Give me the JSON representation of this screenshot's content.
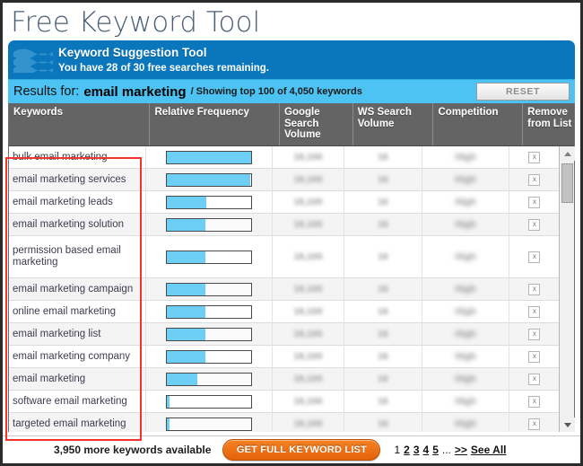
{
  "page_title": "Free Keyword Tool",
  "banner": {
    "icon": "waves-icon",
    "title": "Keyword Suggestion Tool",
    "subtitle": "You have 28 of 30 free searches remaining."
  },
  "results_bar": {
    "label": "Results for:",
    "query": "email marketing",
    "showing": "/ Showing top 100 of 4,050 keywords",
    "reset_label": "RESET"
  },
  "table": {
    "columns": [
      "Keywords",
      "Relative Frequency",
      "Google Search Volume",
      "WS Search Volume",
      "Competition",
      "Remove from List"
    ],
    "rows": [
      {
        "keyword": "bulk email marketing",
        "frequency_pct": 100,
        "google_search_volume": "18,100",
        "ws_search_volume": "16",
        "competition": "High",
        "remove": "x"
      },
      {
        "keyword": "email marketing services",
        "frequency_pct": 99,
        "google_search_volume": "18,100",
        "ws_search_volume": "16",
        "competition": "High",
        "remove": "x"
      },
      {
        "keyword": "email marketing leads",
        "frequency_pct": 47,
        "google_search_volume": "18,100",
        "ws_search_volume": "16",
        "competition": "High",
        "remove": "x"
      },
      {
        "keyword": "email marketing solution",
        "frequency_pct": 46,
        "google_search_volume": "18,100",
        "ws_search_volume": "16",
        "competition": "High",
        "remove": "x"
      },
      {
        "keyword": "permission based email marketing",
        "frequency_pct": 46,
        "google_search_volume": "18,100",
        "ws_search_volume": "16",
        "competition": "High",
        "remove": "x"
      },
      {
        "keyword": "email marketing campaign",
        "frequency_pct": 46,
        "google_search_volume": "18,100",
        "ws_search_volume": "16",
        "competition": "High",
        "remove": "x"
      },
      {
        "keyword": "online email marketing",
        "frequency_pct": 46,
        "google_search_volume": "18,100",
        "ws_search_volume": "16",
        "competition": "High",
        "remove": "x"
      },
      {
        "keyword": "email marketing list",
        "frequency_pct": 46,
        "google_search_volume": "18,100",
        "ws_search_volume": "16",
        "competition": "High",
        "remove": "x"
      },
      {
        "keyword": "email marketing company",
        "frequency_pct": 46,
        "google_search_volume": "18,100",
        "ws_search_volume": "16",
        "competition": "High",
        "remove": "x"
      },
      {
        "keyword": "email marketing",
        "frequency_pct": 36,
        "google_search_volume": "18,100",
        "ws_search_volume": "16",
        "competition": "High",
        "remove": "x"
      },
      {
        "keyword": "software email marketing",
        "frequency_pct": 3,
        "google_search_volume": "18,100",
        "ws_search_volume": "16",
        "competition": "High",
        "remove": "x"
      },
      {
        "keyword": "targeted email marketing",
        "frequency_pct": 3,
        "google_search_volume": "18,100",
        "ws_search_volume": "16",
        "competition": "High",
        "remove": "x"
      }
    ]
  },
  "footer": {
    "more_keywords": "3,950 more keywords available",
    "cta_label": "GET FULL KEYWORD LIST",
    "pages": [
      "1",
      "2",
      "3",
      "4",
      "5"
    ],
    "ellipsis": "...",
    "next_label": ">>",
    "see_all_label": "See All"
  },
  "colors": {
    "banner_blue": "#0a77bd",
    "results_blue": "#4cc3f2",
    "bar_fill": "#6dcff6",
    "header_gray": "#646464",
    "cta_orange": "#f58220",
    "annotation_red": "#f4332d"
  }
}
